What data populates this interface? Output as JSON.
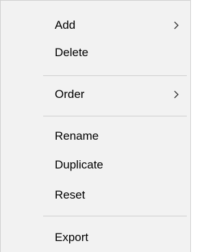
{
  "context_menu": {
    "items": [
      {
        "label": "Add",
        "submenu_icon": "chevron-right-icon"
      },
      {
        "label": "Delete"
      },
      {
        "label": "Order",
        "submenu_icon": "chevron-right-icon"
      },
      {
        "label": "Rename"
      },
      {
        "label": "Duplicate"
      },
      {
        "label": "Reset"
      },
      {
        "label": "Export"
      }
    ]
  },
  "colors": {
    "menu_background": "#f2f2f2",
    "separator": "#cfcfcf",
    "border": "#d0d0d0",
    "text": "#000000"
  }
}
